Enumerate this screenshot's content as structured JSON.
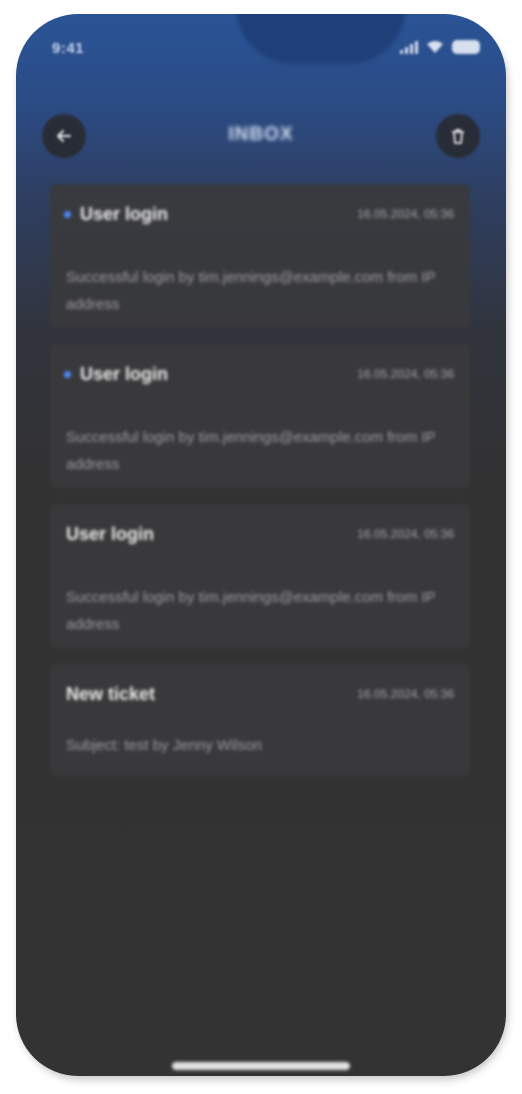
{
  "status_bar": {
    "time": "9:41",
    "icons": [
      "signal-icon",
      "wifi-icon",
      "battery-icon"
    ]
  },
  "header": {
    "title": "INBOX",
    "back_icon": "arrow-left-icon",
    "delete_icon": "trash-icon"
  },
  "messages": [
    {
      "title": "User login",
      "date": "16.05.2024, 05:36",
      "body": "Successful login by tim.jennings@example.com from IP address",
      "unread": true
    },
    {
      "title": "User login",
      "date": "16.05.2024, 05:36",
      "body": "Successful login by tim.jennings@example.com from IP address",
      "unread": true
    },
    {
      "title": "User login",
      "date": "16.05.2024, 05:36",
      "body": "Successful login by tim.jennings@example.com from IP address",
      "unread": false
    },
    {
      "title": "New ticket",
      "date": "16.05.2024, 05:36",
      "body": "Subject: test by Jenny Wilson",
      "unread": false
    }
  ],
  "colors": {
    "header_gradient_top": "#2a5496",
    "background": "#333333",
    "card": "#3a3a3c",
    "unread_dot": "#4f8cff"
  }
}
